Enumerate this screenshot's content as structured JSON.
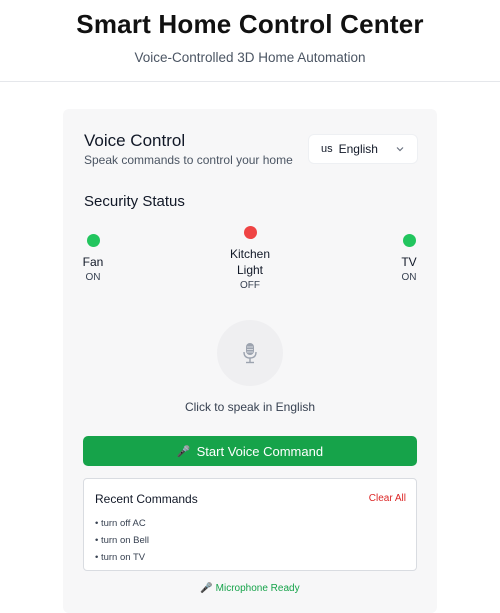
{
  "header": {
    "title": "Smart Home Control Center",
    "subtitle": "Voice-Controlled 3D Home Automation"
  },
  "voice_control": {
    "title": "Voice Control",
    "subtitle": "Speak commands to control your home",
    "language": {
      "flag_text": "us",
      "selected": "English"
    }
  },
  "security": {
    "title": "Security Status",
    "devices": [
      {
        "name": "Fan",
        "state": "ON",
        "status_color": "#22c55e"
      },
      {
        "name": "Kitchen Light",
        "state": "OFF",
        "status_color": "#ef4444"
      },
      {
        "name": "TV",
        "state": "ON",
        "status_color": "#22c55e"
      }
    ]
  },
  "mic": {
    "icon": "microphone-icon",
    "hint": "Click to speak in English"
  },
  "start_button": {
    "icon": "microphone-icon",
    "label": "Start Voice Command"
  },
  "recent": {
    "title": "Recent Commands",
    "clear_label": "Clear All",
    "items": [
      "• turn off AC",
      "• turn on Bell",
      "• turn on TV"
    ]
  },
  "status": {
    "icon": "microphone-icon",
    "text": "Microphone Ready"
  },
  "colors": {
    "accent": "#16a34a",
    "danger": "#dc2626",
    "on": "#22c55e",
    "off": "#ef4444"
  }
}
